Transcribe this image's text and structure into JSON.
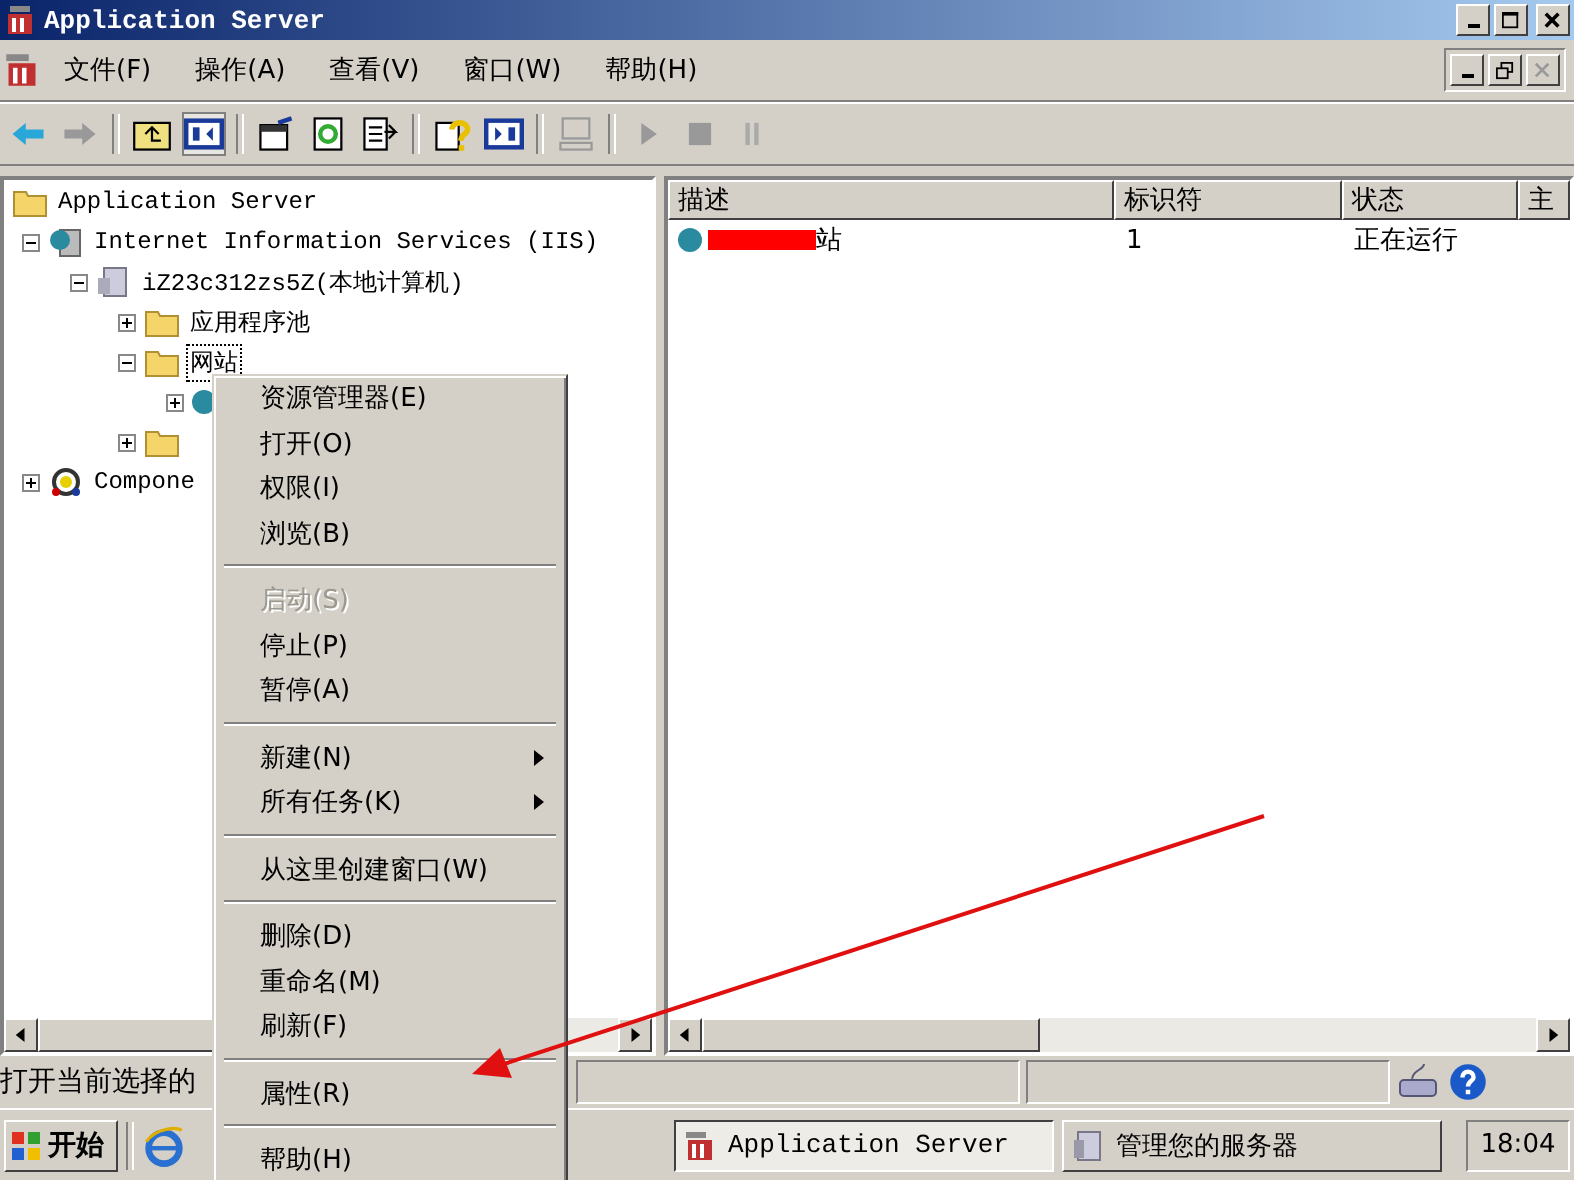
{
  "window": {
    "title": "Application Server"
  },
  "menubar": [
    {
      "label": "文件(F)"
    },
    {
      "label": "操作(A)"
    },
    {
      "label": "查看(V)"
    },
    {
      "label": "窗口(W)"
    },
    {
      "label": "帮助(H)"
    }
  ],
  "tree": [
    {
      "label": "Application Server",
      "kind": "folder",
      "selected": false,
      "children": [
        {
          "label": "Internet Information Services (IIS)",
          "kind": "iis",
          "expanded": true,
          "selected": false,
          "children": [
            {
              "label": "iZ23c312zs5Z(本地计算机)",
              "kind": "computer",
              "expanded": true,
              "selected": false,
              "children": [
                {
                  "label": "应用程序池",
                  "kind": "folder",
                  "expanded": false,
                  "selected": false
                },
                {
                  "label": "网站",
                  "kind": "folder",
                  "expanded": true,
                  "selected": true,
                  "children": [
                    {
                      "expanded": false,
                      "selected": false
                    }
                  ]
                },
                {
                  "kind": "folder",
                  "expanded": false,
                  "selected": false
                }
              ]
            }
          ]
        },
        {
          "label": "Compone",
          "kind": "component",
          "expanded": false,
          "selected": false
        }
      ]
    }
  ],
  "list": {
    "columns": [
      "描述",
      "标识符",
      "状态",
      "主"
    ],
    "rows": [
      {
        "cells": [
          "站",
          "1",
          "正在运行"
        ],
        "redacted": true
      }
    ]
  },
  "context_menu": [
    {
      "kind": "item",
      "label": "资源管理器(E)",
      "disabled": false,
      "submenu": false
    },
    {
      "kind": "item",
      "label": "打开(O)",
      "disabled": false,
      "submenu": false
    },
    {
      "kind": "item",
      "label": "权限(I)",
      "disabled": false,
      "submenu": false
    },
    {
      "kind": "item",
      "label": "浏览(B)",
      "disabled": false,
      "submenu": false
    },
    {
      "kind": "separator"
    },
    {
      "kind": "item",
      "label": "启动(S)",
      "disabled": true,
      "submenu": false
    },
    {
      "kind": "item",
      "label": "停止(P)",
      "disabled": false,
      "submenu": false
    },
    {
      "kind": "item",
      "label": "暂停(A)",
      "disabled": false,
      "submenu": false
    },
    {
      "kind": "separator"
    },
    {
      "kind": "item",
      "label": "新建(N)",
      "disabled": false,
      "submenu": true
    },
    {
      "kind": "item",
      "label": "所有任务(K)",
      "disabled": false,
      "submenu": true
    },
    {
      "kind": "separator"
    },
    {
      "kind": "item",
      "label": "从这里创建窗口(W)",
      "disabled": false,
      "submenu": false
    },
    {
      "kind": "separator"
    },
    {
      "kind": "item",
      "label": "删除(D)",
      "disabled": false,
      "submenu": false
    },
    {
      "kind": "item",
      "label": "重命名(M)",
      "disabled": false,
      "submenu": false
    },
    {
      "kind": "item",
      "label": "刷新(F)",
      "disabled": false,
      "submenu": false
    },
    {
      "kind": "separator"
    },
    {
      "kind": "item",
      "label": "属性(R)",
      "disabled": false,
      "submenu": false
    },
    {
      "kind": "separator"
    },
    {
      "kind": "item",
      "label": "帮助(H)",
      "disabled": false,
      "submenu": false
    }
  ],
  "status_bar": {
    "text": "打开当前选择的"
  },
  "taskbar": {
    "start": "开始",
    "tasks": [
      {
        "label": "Application Server",
        "kind": "mmc",
        "selected": true
      },
      {
        "label": "管理您的服务器",
        "kind": "server",
        "selected": false
      }
    ],
    "clock": "18:04"
  }
}
